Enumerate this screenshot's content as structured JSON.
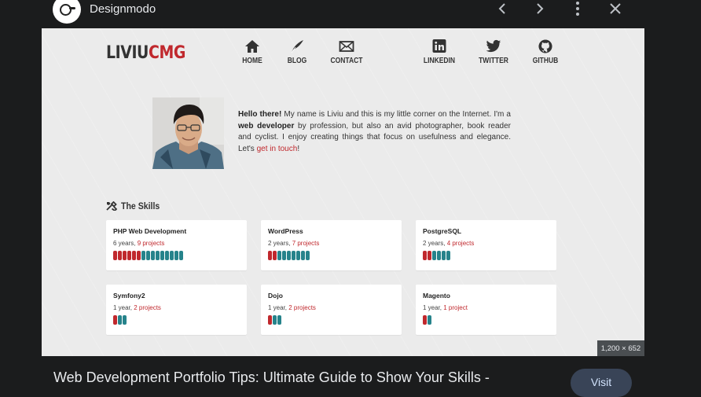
{
  "topbar": {
    "site_name": "Designmodo",
    "icons": [
      "chevron-left-icon",
      "chevron-right-icon",
      "more-vert-icon",
      "close-icon"
    ]
  },
  "screenshot": {
    "brand_part1": "LIVIU",
    "brand_part2": "CMG",
    "nav": [
      {
        "label": "HOME",
        "icon": "home-icon"
      },
      {
        "label": "BLOG",
        "icon": "quill-icon"
      },
      {
        "label": "CONTACT",
        "icon": "envelope-icon"
      },
      {
        "label": "LINKEDIN",
        "icon": "linkedin-icon"
      },
      {
        "label": "TWITTER",
        "icon": "twitter-icon"
      },
      {
        "label": "GITHUB",
        "icon": "github-icon"
      }
    ],
    "intro": {
      "greeting": "Hello there!",
      "text1": " My name is Liviu and this is my little corner on the Internet. I'm a ",
      "role": "web developer",
      "text2": " by profession, but also an avid photographer, book reader and cyclist. I enjoy creating things that focus on usefulness and elegance. Let's ",
      "link": "get in touch",
      "text3": "!"
    },
    "skills_title": "The Skills",
    "skills": [
      {
        "name": "PHP Web Development",
        "years": "6 years, ",
        "projects": "9 projects",
        "red": 6,
        "teal": 9
      },
      {
        "name": "WordPress",
        "years": "2 years, ",
        "projects": "7 projects",
        "red": 2,
        "teal": 7
      },
      {
        "name": "PostgreSQL",
        "years": "2 years, ",
        "projects": "4 projects",
        "red": 2,
        "teal": 4
      },
      {
        "name": "Symfony2",
        "years": "1 year, ",
        "projects": "2 projects",
        "red": 1,
        "teal": 2
      },
      {
        "name": "Dojo",
        "years": "1 year, ",
        "projects": "2 projects",
        "red": 1,
        "teal": 2
      },
      {
        "name": "Magento",
        "years": "1 year, ",
        "projects": "1 project",
        "red": 1,
        "teal": 1
      }
    ],
    "dimensions": "1,200 × 652"
  },
  "footer": {
    "title": "Web Development Portfolio Tips: Ultimate Guide to Show Your Skills -",
    "visit_label": "Visit"
  },
  "colors": {
    "accent_red": "#c0282d",
    "teal": "#26838b",
    "background": "#1b1c1d"
  }
}
